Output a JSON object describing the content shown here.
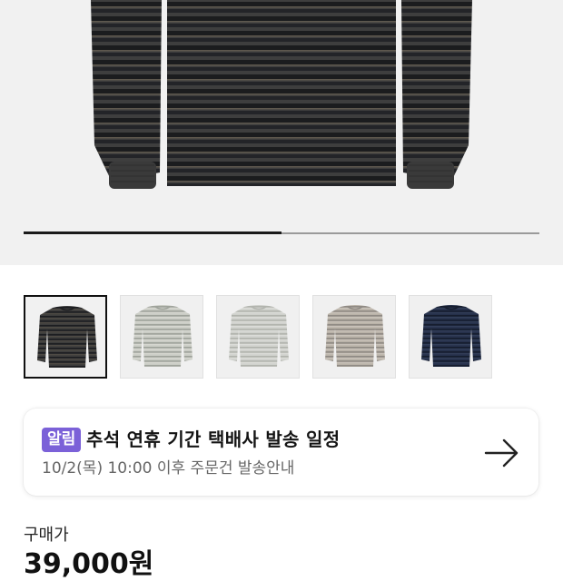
{
  "product": {
    "hero_image": "striped-long-sleeve-tee-charcoal",
    "gallery_position": 0.5,
    "thumbnails": [
      {
        "name": "charcoal-stripe",
        "selected": true
      },
      {
        "name": "light-gray-stripe",
        "selected": false
      },
      {
        "name": "pale-gray-stripe",
        "selected": false
      },
      {
        "name": "beige-gray-stripe",
        "selected": false
      },
      {
        "name": "navy-stripe",
        "selected": false
      }
    ]
  },
  "notice": {
    "badge": "알림",
    "title": "추석 연휴 기간 택배사 발송 일정",
    "subtitle": "10/2(목) 10:00 이후 주문건 발송안내",
    "arrow_icon": "arrow-right-icon"
  },
  "purchase": {
    "label": "구매가",
    "price": "39,000원"
  },
  "colors": {
    "accent": "#7b61d8",
    "hero_bg": "#f1f1f1",
    "progress_track": "#9a9a9a",
    "progress_fill": "#1a1a1a"
  }
}
